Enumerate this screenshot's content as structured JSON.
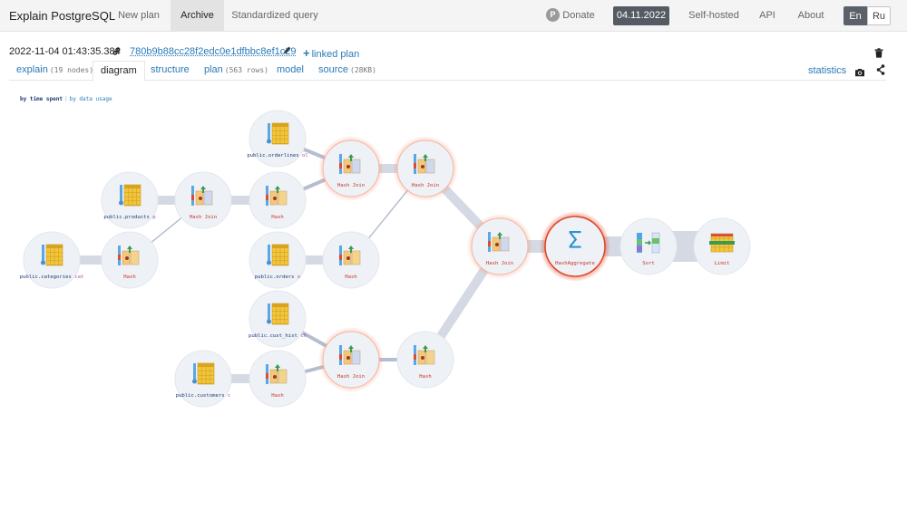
{
  "nav": {
    "brand": "Explain PostgreSQL",
    "new_plan": "New plan",
    "archive": "Archive",
    "standardized": "Standardized query",
    "donate": "Donate",
    "donate_icon": "P",
    "date": "04.11.2022",
    "self_hosted": "Self-hosted",
    "api": "API",
    "about": "About",
    "lang_en": "En",
    "lang_ru": "Ru"
  },
  "plan": {
    "date": "2022-11-04 01:43:35.384",
    "hash": "780b9b88cc28f2edc0e1dfbbc8ef1c29",
    "linked_plan": "linked plan"
  },
  "tabs": [
    {
      "label": "explain",
      "sub": "(19 nodes)"
    },
    {
      "label": "diagram",
      "sub": ""
    },
    {
      "label": "structure",
      "sub": ""
    },
    {
      "label": "plan",
      "sub": "(563 rows)"
    },
    {
      "label": "model",
      "sub": ""
    },
    {
      "label": "source",
      "sub": "(28KB)"
    }
  ],
  "statistics": "statistics",
  "sort": {
    "by_time": "by time spent",
    "sep": "|",
    "by_data": "by data usage"
  },
  "colors": {
    "accent_link": "#2a7ab8",
    "hot": "#e0482a",
    "table_yellow": "#f2c53d",
    "node_bg": "#eef1f5"
  },
  "diagram": {
    "nodes": [
      {
        "id": "orderlines",
        "type": "table",
        "label": "public.orderlines",
        "alias": "ol",
        "heat": 0
      },
      {
        "id": "products",
        "type": "table",
        "label": "public.products",
        "alias": "p",
        "heat": 0
      },
      {
        "id": "categories",
        "type": "table",
        "label": "public.categories",
        "alias": "cat",
        "heat": 0
      },
      {
        "id": "orders",
        "type": "table",
        "label": "public.orders",
        "alias": "o",
        "heat": 0
      },
      {
        "id": "cust_hist",
        "type": "table",
        "label": "public.cust_hist",
        "alias": "ch",
        "heat": 0
      },
      {
        "id": "customers",
        "type": "table",
        "label": "public.customers",
        "alias": "c",
        "heat": 0
      },
      {
        "id": "hash_cat",
        "type": "hash",
        "label": "Hash",
        "heat": 0
      },
      {
        "id": "hj_prod",
        "type": "hashjoin",
        "label": "Hash Join",
        "heat": 0
      },
      {
        "id": "hash_pj",
        "type": "hash",
        "label": "Hash",
        "heat": 0
      },
      {
        "id": "hj_ol",
        "type": "hashjoin",
        "label": "Hash Join",
        "heat": 1
      },
      {
        "id": "hj_o",
        "type": "hashjoin",
        "label": "Hash Join",
        "heat": 1
      },
      {
        "id": "hash_o",
        "type": "hash",
        "label": "Hash",
        "heat": 0
      },
      {
        "id": "hash_c",
        "type": "hash",
        "label": "Hash",
        "heat": 0
      },
      {
        "id": "hj_ch",
        "type": "hashjoin",
        "label": "Hash Join",
        "heat": 1
      },
      {
        "id": "hash_ch",
        "type": "hash",
        "label": "Hash",
        "heat": 0
      },
      {
        "id": "hj_main",
        "type": "hashjoin",
        "label": "Hash Join",
        "heat": 1
      },
      {
        "id": "agg",
        "type": "aggregate",
        "label": "HashAggregate",
        "heat": 3
      },
      {
        "id": "sort",
        "type": "sort",
        "label": "Sort",
        "heat": 0
      },
      {
        "id": "limit",
        "type": "limit",
        "label": "Limit",
        "heat": 0
      }
    ],
    "edges": [
      {
        "from": "categories",
        "to": "hash_cat",
        "w": 2
      },
      {
        "from": "hash_cat",
        "to": "hj_prod",
        "w": 0
      },
      {
        "from": "products",
        "to": "hj_prod",
        "w": 2
      },
      {
        "from": "hj_prod",
        "to": "hash_pj",
        "w": 2
      },
      {
        "from": "hash_pj",
        "to": "hj_ol",
        "w": 1
      },
      {
        "from": "orderlines",
        "to": "hj_ol",
        "w": 1
      },
      {
        "from": "hj_ol",
        "to": "hj_o",
        "w": 2
      },
      {
        "from": "orders",
        "to": "hash_o",
        "w": 2
      },
      {
        "from": "hash_o",
        "to": "hj_o",
        "w": 0
      },
      {
        "from": "hj_o",
        "to": "hj_main",
        "w": 2
      },
      {
        "from": "customers",
        "to": "hash_c",
        "w": 2
      },
      {
        "from": "hash_c",
        "to": "hj_ch",
        "w": 1
      },
      {
        "from": "cust_hist",
        "to": "hj_ch",
        "w": 1
      },
      {
        "from": "hj_ch",
        "to": "hash_ch",
        "w": 1
      },
      {
        "from": "hash_ch",
        "to": "hj_main",
        "w": 2
      },
      {
        "from": "hj_main",
        "to": "agg",
        "w": 3
      },
      {
        "from": "agg",
        "to": "sort",
        "w": 4
      },
      {
        "from": "sort",
        "to": "limit",
        "w": 5
      }
    ]
  }
}
